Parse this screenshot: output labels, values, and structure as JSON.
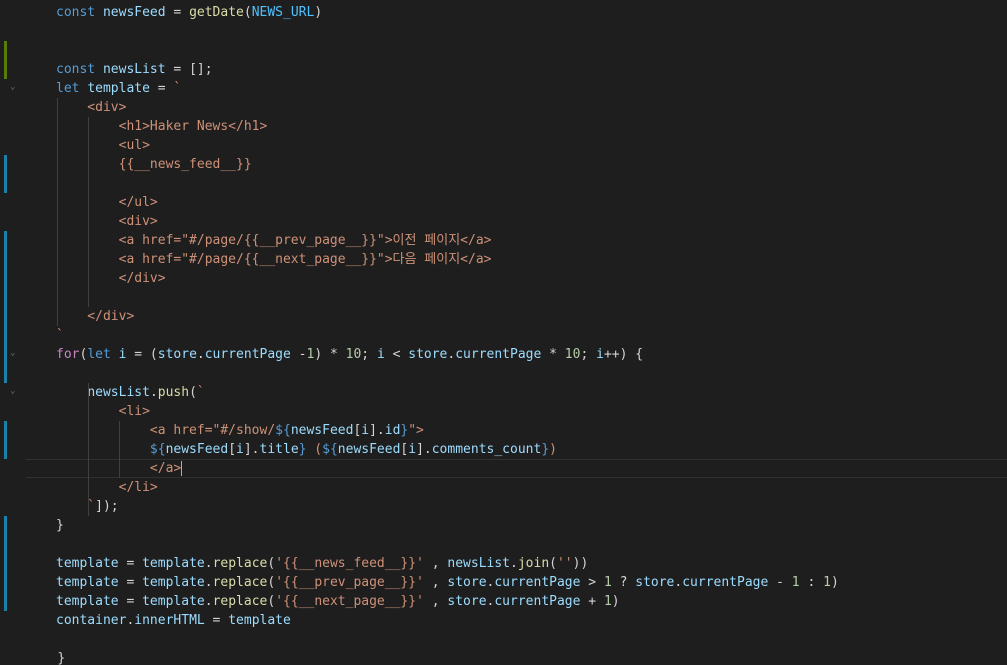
{
  "theme": {
    "background": "#1e1e1e",
    "keyword": "#569cd6",
    "control": "#c586c0",
    "variable": "#9cdcfe",
    "constant": "#4fc1ff",
    "function": "#dcdcaa",
    "string": "#ce9178",
    "number": "#b5cea8",
    "plain": "#d4d4d4",
    "gutter_modified": "#1b81a8",
    "gutter_added": "#587c0c"
  },
  "editor": {
    "lines": [
      [
        [
          "kw",
          "const"
        ],
        [
          "op",
          " "
        ],
        [
          "var",
          "newsFeed"
        ],
        [
          "op",
          " = "
        ],
        [
          "fn",
          "getDate"
        ],
        [
          "op",
          "("
        ],
        [
          "const",
          "NEWS_URL"
        ],
        [
          "op",
          ")"
        ]
      ],
      [],
      [],
      [
        [
          "kw",
          "const"
        ],
        [
          "op",
          " "
        ],
        [
          "var",
          "newsList"
        ],
        [
          "op",
          " = [];"
        ]
      ],
      [
        [
          "kw",
          "let"
        ],
        [
          "op",
          " "
        ],
        [
          "var",
          "template"
        ],
        [
          "op",
          " = "
        ],
        [
          "str",
          "`"
        ]
      ],
      [
        [
          "str",
          "    <div>"
        ]
      ],
      [
        [
          "str",
          "        <h1>Haker News</h1>"
        ]
      ],
      [
        [
          "str",
          "        <ul>"
        ]
      ],
      [
        [
          "str",
          "        {{__news_feed__}}"
        ]
      ],
      [],
      [
        [
          "str",
          "        </ul>"
        ]
      ],
      [
        [
          "str",
          "        <div>"
        ]
      ],
      [
        [
          "str",
          "        <a href=\"#/page/{{__prev_page__}}\">이전 페이지</a>"
        ]
      ],
      [
        [
          "str",
          "        <a href=\"#/page/{{__next_page__}}\">다음 페이지</a>"
        ]
      ],
      [
        [
          "str",
          "        </div>"
        ]
      ],
      [],
      [
        [
          "str",
          "    </div>"
        ]
      ],
      [
        [
          "str",
          "`"
        ]
      ],
      [
        [
          "ctrl",
          "for"
        ],
        [
          "op",
          "("
        ],
        [
          "kw",
          "let"
        ],
        [
          "op",
          " "
        ],
        [
          "var",
          "i"
        ],
        [
          "op",
          " = ("
        ],
        [
          "var",
          "store"
        ],
        [
          "op",
          "."
        ],
        [
          "var",
          "currentPage"
        ],
        [
          "op",
          " -"
        ],
        [
          "num",
          "1"
        ],
        [
          "op",
          ") * "
        ],
        [
          "num",
          "10"
        ],
        [
          "op",
          "; "
        ],
        [
          "var",
          "i"
        ],
        [
          "op",
          " < "
        ],
        [
          "var",
          "store"
        ],
        [
          "op",
          "."
        ],
        [
          "var",
          "currentPage"
        ],
        [
          "op",
          " * "
        ],
        [
          "num",
          "10"
        ],
        [
          "op",
          "; "
        ],
        [
          "var",
          "i"
        ],
        [
          "op",
          "++) {"
        ]
      ],
      [],
      [
        [
          "op",
          "    "
        ],
        [
          "var",
          "newsList"
        ],
        [
          "op",
          "."
        ],
        [
          "fn",
          "push"
        ],
        [
          "op",
          "("
        ],
        [
          "str",
          "`"
        ]
      ],
      [
        [
          "str",
          "        <li>"
        ]
      ],
      [
        [
          "str",
          "            <a href=\"#/show/"
        ],
        [
          "tmpl",
          "${"
        ],
        [
          "var",
          "newsFeed"
        ],
        [
          "op",
          "["
        ],
        [
          "var",
          "i"
        ],
        [
          "op",
          "]."
        ],
        [
          "var",
          "id"
        ],
        [
          "tmpl",
          "}"
        ],
        [
          "str",
          "\">"
        ]
      ],
      [
        [
          "op",
          "            "
        ],
        [
          "tmpl",
          "${"
        ],
        [
          "var",
          "newsFeed"
        ],
        [
          "op",
          "["
        ],
        [
          "var",
          "i"
        ],
        [
          "op",
          "]."
        ],
        [
          "var",
          "title"
        ],
        [
          "tmpl",
          "}"
        ],
        [
          "str",
          " ("
        ],
        [
          "tmpl",
          "${"
        ],
        [
          "var",
          "newsFeed"
        ],
        [
          "op",
          "["
        ],
        [
          "var",
          "i"
        ],
        [
          "op",
          "]."
        ],
        [
          "var",
          "comments_count"
        ],
        [
          "tmpl",
          "}"
        ],
        [
          "str",
          ")"
        ]
      ],
      [
        [
          "str",
          "            </a>"
        ]
      ],
      [
        [
          "str",
          "        </li>"
        ]
      ],
      [
        [
          "str",
          "    `"
        ],
        [
          "op",
          "]);"
        ]
      ],
      [
        [
          "op",
          "}"
        ]
      ],
      [],
      [
        [
          "var",
          "template"
        ],
        [
          "op",
          " = "
        ],
        [
          "var",
          "template"
        ],
        [
          "op",
          "."
        ],
        [
          "fn",
          "replace"
        ],
        [
          "op",
          "("
        ],
        [
          "str",
          "'{{__news_feed__}}'"
        ],
        [
          "op",
          " , "
        ],
        [
          "var",
          "newsList"
        ],
        [
          "op",
          "."
        ],
        [
          "fn",
          "join"
        ],
        [
          "op",
          "("
        ],
        [
          "str",
          "''"
        ],
        [
          "op",
          "))"
        ]
      ],
      [
        [
          "var",
          "template"
        ],
        [
          "op",
          " = "
        ],
        [
          "var",
          "template"
        ],
        [
          "op",
          "."
        ],
        [
          "fn",
          "replace"
        ],
        [
          "op",
          "("
        ],
        [
          "str",
          "'{{__prev_page__}}'"
        ],
        [
          "op",
          " , "
        ],
        [
          "var",
          "store"
        ],
        [
          "op",
          "."
        ],
        [
          "var",
          "currentPage"
        ],
        [
          "op",
          " > "
        ],
        [
          "num",
          "1"
        ],
        [
          "op",
          " ? "
        ],
        [
          "var",
          "store"
        ],
        [
          "op",
          "."
        ],
        [
          "var",
          "currentPage"
        ],
        [
          "op",
          " - "
        ],
        [
          "num",
          "1"
        ],
        [
          "op",
          " : "
        ],
        [
          "num",
          "1"
        ],
        [
          "op",
          ")"
        ]
      ],
      [
        [
          "var",
          "template"
        ],
        [
          "op",
          " = "
        ],
        [
          "var",
          "template"
        ],
        [
          "op",
          "."
        ],
        [
          "fn",
          "replace"
        ],
        [
          "op",
          "("
        ],
        [
          "str",
          "'{{__next_page__}}'"
        ],
        [
          "op",
          " , "
        ],
        [
          "var",
          "store"
        ],
        [
          "op",
          "."
        ],
        [
          "var",
          "currentPage"
        ],
        [
          "op",
          " + "
        ],
        [
          "num",
          "1"
        ],
        [
          "op",
          ")"
        ]
      ],
      [
        [
          "var",
          "container"
        ],
        [
          "op",
          "."
        ],
        [
          "var",
          "innerHTML"
        ],
        [
          "op",
          " = "
        ],
        [
          "var",
          "template"
        ]
      ]
    ],
    "closing_brace": "}"
  }
}
